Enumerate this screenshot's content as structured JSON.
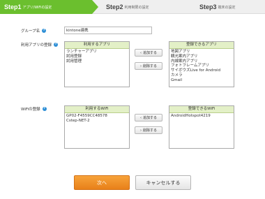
{
  "steps": [
    {
      "num": "Step1",
      "label": "アプリ/WiFiの設定"
    },
    {
      "num": "Step2",
      "label": "利用制限の設定"
    },
    {
      "num": "Step3",
      "label": "端末の設定"
    }
  ],
  "group": {
    "label": "グループ名",
    "value": "kintone連携"
  },
  "apps": {
    "label": "利用アプリの登録",
    "used_header": "利用するアプリ",
    "used_items": [
      "ランチャーアプリ",
      "試用登録",
      "試用管理"
    ],
    "available_header": "登録できるアプリ",
    "available_items": [
      "地図アプリ",
      "観光案内アプリ",
      "内線案内アプリ",
      "フォトフレームアプリ",
      "サイボウズLive for Android",
      "カメラ",
      "Gmail"
    ],
    "add_label": "追加する",
    "remove_label": "削除する"
  },
  "wifi": {
    "label": "WiFiの登録",
    "used_header": "利用するWiFi",
    "used_items": [
      "GP02-F4559CC48578",
      "Cstep-NET-2"
    ],
    "available_header": "登録できるWiFi",
    "available_items": [
      "AndroidHotspot4219"
    ],
    "add_label": "追加する",
    "remove_label": "削除する"
  },
  "buttons": {
    "next": "次へ",
    "cancel": "キャンセルする"
  },
  "colors": {
    "step_active": "#6bbf2e",
    "list_header": "#e3f0c7",
    "next_button": "#f08c24",
    "help_icon": "#2e8fd6"
  }
}
